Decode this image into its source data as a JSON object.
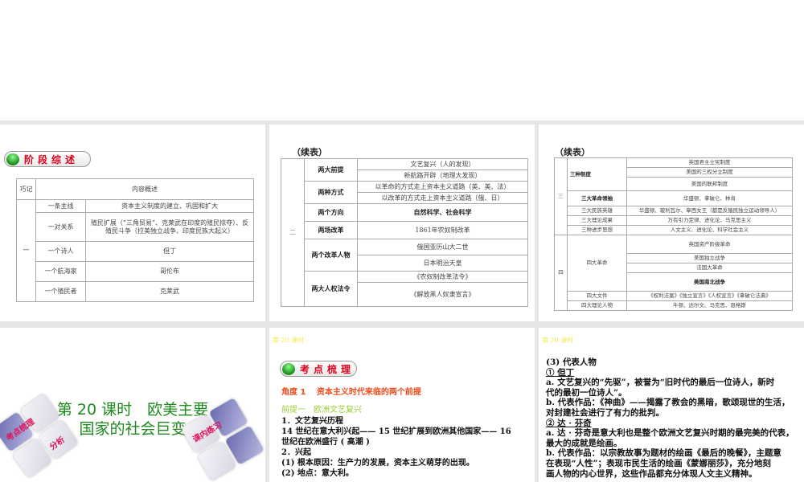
{
  "slide1": {
    "badge": "阶段综述",
    "head": [
      "巧记",
      "内容概述"
    ],
    "group": "一",
    "rows": [
      [
        "一条主线",
        "资本主义制度的建立、巩固和扩大"
      ],
      [
        "一对关系",
        "殖民扩展（“三角贸易”、克莱武在印度的殖民掠夺）、反殖民斗争（拉美独立战争、印度民族大起义）"
      ],
      [
        "一个诗人",
        "但丁"
      ],
      [
        "一个航海家",
        "哥伦布"
      ],
      [
        "一个殖民者",
        "克莱武"
      ]
    ]
  },
  "slide2": {
    "title": "（续表）",
    "group": "二",
    "rows": [
      {
        "k": "两大前提",
        "v": [
          "文艺复兴（人的发现）",
          "新航路开辟（地理大发现）"
        ]
      },
      {
        "k": "两种方式",
        "v": [
          "以革命的方式走上资本主义道路（英、美、法）",
          "以改革的方式走上资本主义道路（俄、日）"
        ]
      },
      {
        "k": "两个方向",
        "v": [
          "自然科学、社会科学"
        ]
      },
      {
        "k": "两场改革",
        "v": [
          "1861年农奴制改革"
        ]
      },
      {
        "k": "两个改革人物",
        "v": [
          "俄国亚历山大二世",
          "日本明治天皇"
        ]
      },
      {
        "k": "两大人权法令",
        "v": [
          "《农奴制改革法令》",
          "《解放黑人奴隶宣言》"
        ]
      }
    ]
  },
  "slide3": {
    "title": "（续表）",
    "g3": "三",
    "g4": "四",
    "sanzhong": "三种制度",
    "sanzhong_v": [
      "英国君主立宪制度",
      "美国的三权分立制度",
      "美国的联邦制度"
    ],
    "rows3": [
      [
        "三大革命领袖",
        "华盛顿、拿破仑、林肯"
      ],
      [
        "三大民族英雄",
        "华盛顿、玻利瓦尔、章西女王（都是反殖民独立运动领导人）"
      ],
      [
        "三大理论成果",
        "万有引力定律、进化论、马克思主义"
      ],
      [
        "三种进步思想",
        "人文主义、进化论、科学社会主义"
      ]
    ],
    "sida": "四大革命",
    "sida_v": [
      "英国资产阶级革命",
      "美国独立战争",
      "法国大革命",
      "美国南北战争"
    ],
    "rows4": [
      [
        "四大文件",
        "《权利法案》《独立宣言》《人权宣言》《拿破仑法典》"
      ],
      [
        "四大理论人物",
        "牛顿、达尔文、马克思、恩格斯"
      ]
    ]
  },
  "slide4": {
    "title1": "第 20 课时　欧美主要",
    "title2": "国家的社会巨变",
    "tile_left1": "考点梳理",
    "tile_left2": "分析",
    "tile_right": "课内练习"
  },
  "slide5": {
    "header": "第 20 课时",
    "badge": "考点梳理",
    "angle": "角度 1　 资本主义时代来临的两个前提",
    "premise": "前提一　欧洲文艺复兴",
    "lines": [
      "1．文艺复兴历程",
      "14 世纪在意大利兴起—— 15 世纪扩展到欧洲其他国家—— 16",
      "世纪在欧洲盛行 ( 高潮 )",
      "2．兴起",
      "(1) 根本原因：生产力的发展，资本主义萌芽的出现。",
      "(2) 地点：意大利。"
    ]
  },
  "slide6": {
    "header": "第 20 课时",
    "lines": [
      "(3) 代表人物",
      "① 但丁",
      "a. 文艺复兴的“先驱”，被誉为“旧时代的最后一位诗人，新时",
      "代的最初一位诗人”。",
      "b. 代表作品：《神曲》——揭露了教会的黑暗，歌颂现世的生活，",
      "对封建社会进行了有力的批判。",
      "② 达 · 芬奇",
      "a. 达 · 芬奇是意大利也是整个欧洲文艺复兴时期的最完美的代表，",
      "最大的成就是绘画。",
      "b. 代表作品：以宗教故事为题材的绘画《最后的晚餐》，主题意",
      "在表现“人性”；表现市民生活的绘画《蒙娜丽莎》，充分地刻",
      "画人物的内心世界，这些作品都充分体现人文主义精神。"
    ]
  }
}
